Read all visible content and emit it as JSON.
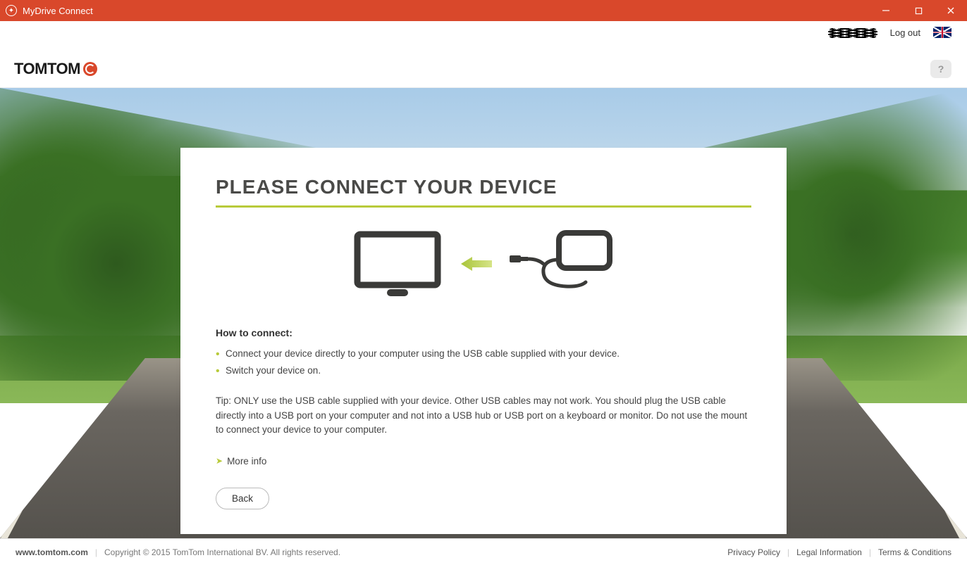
{
  "window": {
    "title": "MyDrive Connect"
  },
  "header": {
    "logout": "Log out",
    "logo": "TOMTOM",
    "help": "?"
  },
  "card": {
    "title": "PLEASE CONNECT YOUR DEVICE",
    "how_title": "How to connect:",
    "bullets": [
      "Connect your device directly to your computer using the USB cable supplied with your device.",
      "Switch your device on."
    ],
    "tip": "Tip: ONLY use the USB cable supplied with your device. Other USB cables may not work. You should plug the USB cable directly into a USB port on your computer and not into a USB hub or USB port on a keyboard or monitor. Do not use the mount to connect your device to your computer.",
    "more_info": "More info",
    "back": "Back"
  },
  "footer": {
    "site": "www.tomtom.com",
    "copyright": "Copyright © 2015 TomTom International BV. All rights reserved.",
    "links": [
      "Privacy Policy",
      "Legal Information",
      "Terms & Conditions"
    ]
  }
}
